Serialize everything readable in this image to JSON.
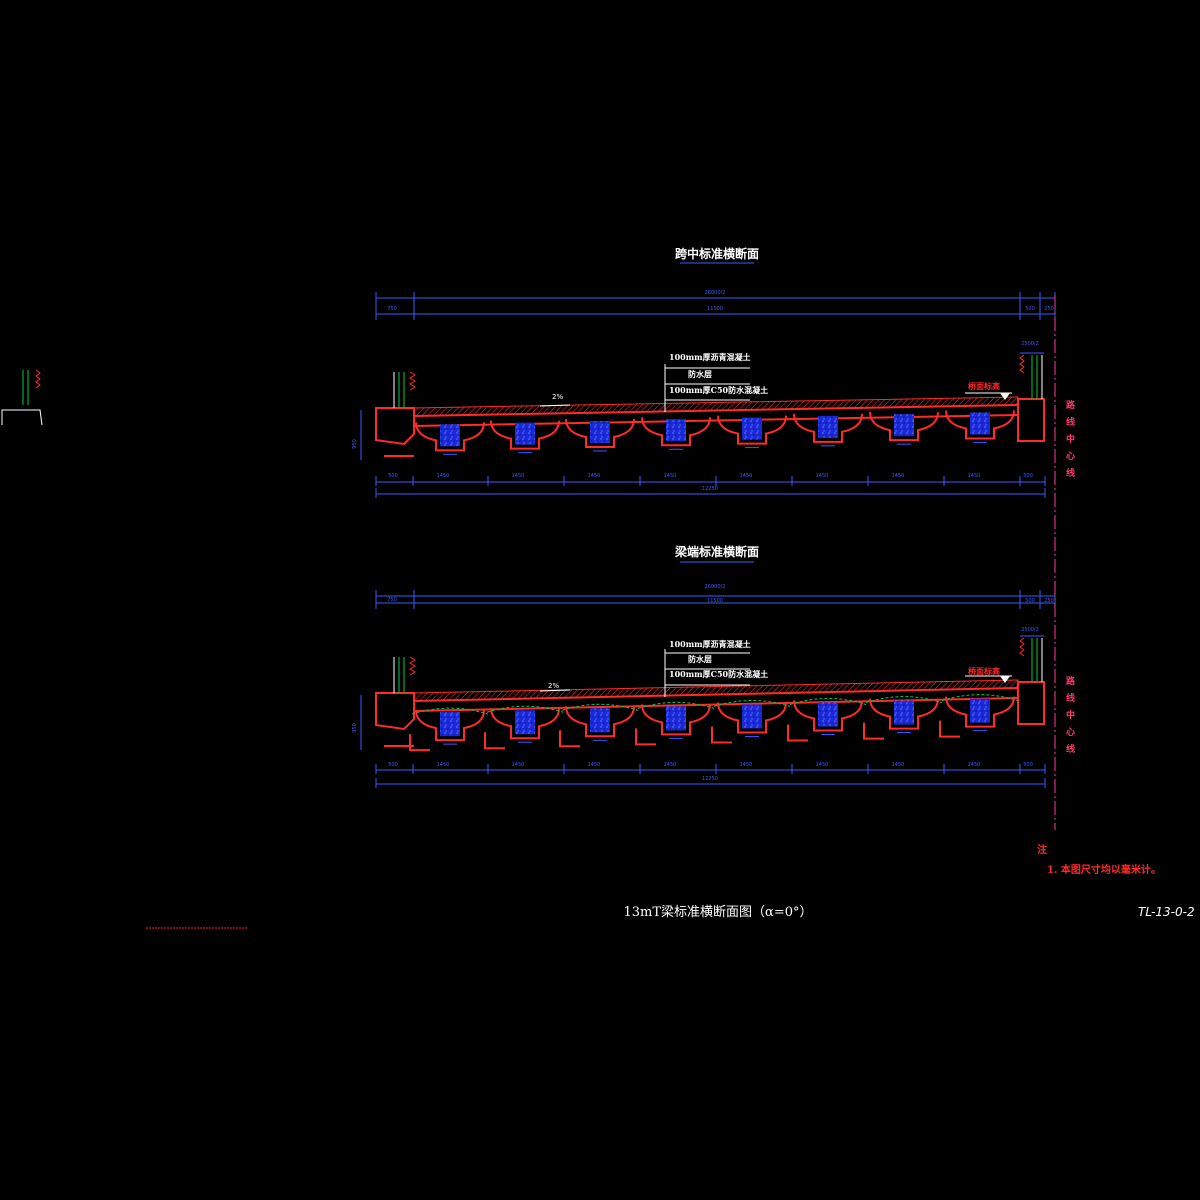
{
  "sections": [
    {
      "title": "跨中标准横断面",
      "overall_label": "26000/2",
      "top_dims": [
        "750",
        "11500",
        "500",
        "250"
      ],
      "right_dim": "2500/2",
      "height_dim": "950",
      "bottom_dims": [
        "500",
        "1450",
        "1450",
        "1450",
        "1450",
        "1450",
        "1450",
        "1450",
        "1450",
        "500"
      ],
      "bottom_total": "12250",
      "layers": [
        "100mm厚沥青混凝土",
        "防水层",
        "100mm厚C50防水混凝土"
      ],
      "slope": "2%",
      "edge_label": "桥面标高",
      "centerline": "路线中心线"
    },
    {
      "title": "梁端标准横断面",
      "overall_label": "26000/2",
      "top_dims": [
        "750",
        "11500",
        "500",
        "250"
      ],
      "right_dim": "2500/2",
      "height_dim": "950",
      "bottom_dims": [
        "500",
        "1450",
        "1450",
        "1450",
        "1450",
        "1450",
        "1450",
        "1450",
        "1450",
        "500"
      ],
      "bottom_total": "12250",
      "layers": [
        "100mm厚沥青混凝土",
        "防水层",
        "100mm厚C50防水混凝土"
      ],
      "slope": "2%",
      "edge_label": "桥面标高",
      "centerline": "路线中心线"
    }
  ],
  "notes": {
    "heading": "注",
    "item": "1. 本图尺寸均以毫米计。"
  },
  "main_title": "13mT梁标准横断面图（α=0°）",
  "drawing_code": "TL-13-0-2",
  "colors": {
    "background": "#000000",
    "structure": "#ff2a2a",
    "dimension": "#3a5bff",
    "centerline": "#ff3a9a",
    "fill": "#2a3aff",
    "railing": "#00cc44",
    "title_underline": "#3a5bff"
  }
}
